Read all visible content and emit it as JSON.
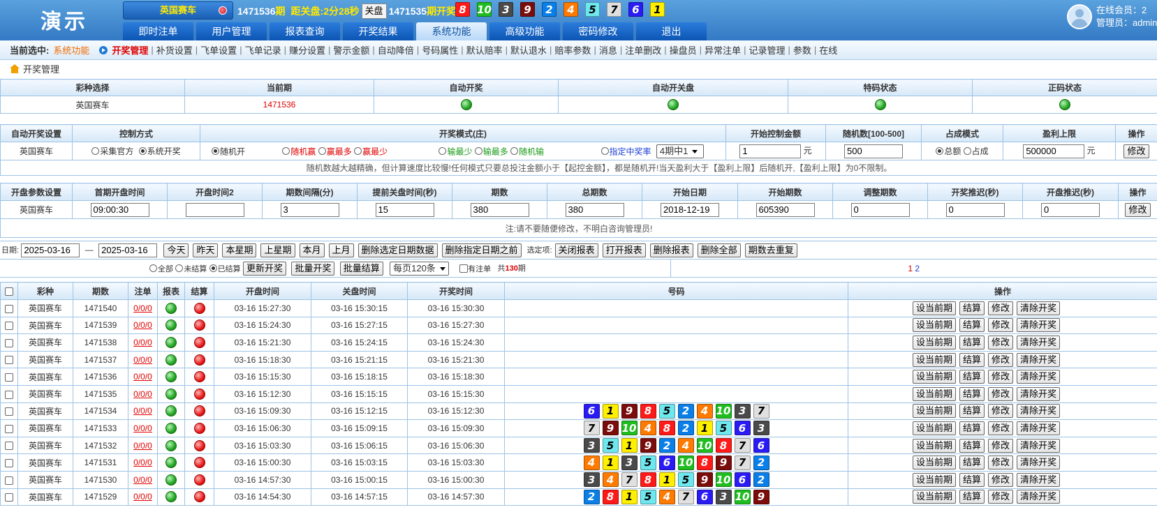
{
  "header": {
    "logo": "演示",
    "lottery": "英国赛车",
    "period": "1471536",
    "period_suffix": "期",
    "close_label": "距关盘:",
    "countdown": "2分28秒",
    "close_button": "关盘",
    "last_period": "1471535",
    "last_label": "期开奖:",
    "last_numbers": [
      8,
      10,
      3,
      9,
      2,
      4,
      5,
      7,
      6,
      1
    ],
    "online_label": "在线会员：2",
    "admin_label": "管理员：admin"
  },
  "nav": [
    "即时注单",
    "用户管理",
    "报表查询",
    "开奖结果",
    "系统功能",
    "高级功能",
    "密码修改",
    "退出"
  ],
  "subnav": {
    "current_label": "当前选中:",
    "current_value": "系统功能",
    "items": [
      "开奖管理",
      "补货设置",
      "飞单设置",
      "飞单记录",
      "赚分设置",
      "警示金额",
      "自动降倍",
      "号码属性",
      "默认赔率",
      "默认退水",
      "赔率参数",
      "消息",
      "注单删改",
      "操盘员",
      "异常注单",
      "记录管理",
      "参数",
      "在线"
    ]
  },
  "breadcrumb": "开奖管理",
  "status_table": {
    "headers": [
      "彩种选择",
      "当前期",
      "自动开奖",
      "自动开关盘",
      "特码状态",
      "正码状态"
    ],
    "lottery": "英国赛车",
    "period": "1471536"
  },
  "auto_table": {
    "headers": [
      "自动开奖设置",
      "控制方式",
      "开奖模式(庄)",
      "开始控制金额",
      "随机数[100-500]",
      "占成模式",
      "盈利上限",
      "操作"
    ],
    "lottery": "英国赛车",
    "control_options": [
      "采集官方",
      "系统开奖"
    ],
    "mode_options": [
      "随机开",
      "随机赢",
      "赢最多",
      "赢最少",
      "输最少",
      "输最多",
      "随机输",
      "指定中奖率"
    ],
    "rate_select": "4期中1",
    "start_amount": "1",
    "unit": "元",
    "random_num": "500",
    "share_options": [
      "总额",
      "占成"
    ],
    "profit_limit": "500000",
    "edit": "修改",
    "note": "随机数越大越精确，但计算速度比较慢!任何模式只要总投注金额小于【起控金额】，都是随机开!当天盈利大于【盈利上限】后随机开,【盈利上限】为0不限制。"
  },
  "param_table": {
    "headers": [
      "开盘参数设置",
      "首期开盘时间",
      "开盘时间2",
      "期数间隔(分)",
      "提前关盘时间(秒)",
      "期数",
      "总期数",
      "开始日期",
      "开始期数",
      "调整期数",
      "开奖推迟(秒)",
      "开盘推迟(秒)",
      "操作"
    ],
    "lottery": "英国赛车",
    "values": [
      "09:00:30",
      "",
      "3",
      "15",
      "380",
      "380",
      "2018-12-19",
      "605390",
      "0",
      "0",
      "0"
    ],
    "edit": "修改",
    "note": "注:请不要随便修改，不明白咨询管理员!"
  },
  "filter": {
    "date_label": "日期:",
    "date_from": "2025-03-16",
    "dash": "—",
    "date_to": "2025-03-16",
    "buttons": [
      "今天",
      "昨天",
      "本星期",
      "上星期",
      "本月",
      "上月",
      "删除选定日期数据",
      "删除指定日期之前"
    ],
    "options_label": "选定项:",
    "option_buttons": [
      "关闭报表",
      "打开报表",
      "删除报表",
      "删除全部",
      "期数去重复"
    ],
    "status_radios": [
      "全部",
      "未结算",
      "已结算"
    ],
    "update_btn": "更新开奖",
    "batch_open": "批量开奖",
    "batch_settle": "批量结算",
    "page_size": "每页120条",
    "has_bet": "有注单",
    "total_prefix": "共",
    "total": "130",
    "total_suffix": "期",
    "page1": "1",
    "page2": "2"
  },
  "results": {
    "headers": [
      "彩种",
      "期数",
      "注单",
      "报表",
      "结算",
      "开盘时间",
      "关盘时间",
      "开奖时间",
      "号码",
      "操作"
    ],
    "actions": [
      "设当前期",
      "结算",
      "修改",
      "清除开奖"
    ],
    "rows": [
      {
        "lottery": "英国赛车",
        "period": "1471540",
        "bets": "0/0/0",
        "open": "03-16 15:27:30",
        "close": "03-16 15:30:15",
        "draw": "03-16 15:30:30",
        "numbers": []
      },
      {
        "lottery": "英国赛车",
        "period": "1471539",
        "bets": "0/0/0",
        "open": "03-16 15:24:30",
        "close": "03-16 15:27:15",
        "draw": "03-16 15:27:30",
        "numbers": []
      },
      {
        "lottery": "英国赛车",
        "period": "1471538",
        "bets": "0/0/0",
        "open": "03-16 15:21:30",
        "close": "03-16 15:24:15",
        "draw": "03-16 15:24:30",
        "numbers": []
      },
      {
        "lottery": "英国赛车",
        "period": "1471537",
        "bets": "0/0/0",
        "open": "03-16 15:18:30",
        "close": "03-16 15:21:15",
        "draw": "03-16 15:21:30",
        "numbers": []
      },
      {
        "lottery": "英国赛车",
        "period": "1471536",
        "bets": "0/0/0",
        "open": "03-16 15:15:30",
        "close": "03-16 15:18:15",
        "draw": "03-16 15:18:30",
        "numbers": []
      },
      {
        "lottery": "英国赛车",
        "period": "1471535",
        "bets": "0/0/0",
        "open": "03-16 15:12:30",
        "close": "03-16 15:15:15",
        "draw": "03-16 15:15:30",
        "numbers": []
      },
      {
        "lottery": "英国赛车",
        "period": "1471534",
        "bets": "0/0/0",
        "open": "03-16 15:09:30",
        "close": "03-16 15:12:15",
        "draw": "03-16 15:12:30",
        "numbers": [
          6,
          1,
          9,
          8,
          5,
          2,
          4,
          10,
          3,
          7
        ]
      },
      {
        "lottery": "英国赛车",
        "period": "1471533",
        "bets": "0/0/0",
        "open": "03-16 15:06:30",
        "close": "03-16 15:09:15",
        "draw": "03-16 15:09:30",
        "numbers": [
          7,
          9,
          10,
          4,
          8,
          2,
          1,
          5,
          6,
          3
        ]
      },
      {
        "lottery": "英国赛车",
        "period": "1471532",
        "bets": "0/0/0",
        "open": "03-16 15:03:30",
        "close": "03-16 15:06:15",
        "draw": "03-16 15:06:30",
        "numbers": [
          3,
          5,
          1,
          9,
          2,
          4,
          10,
          8,
          7,
          6
        ]
      },
      {
        "lottery": "英国赛车",
        "period": "1471531",
        "bets": "0/0/0",
        "open": "03-16 15:00:30",
        "close": "03-16 15:03:15",
        "draw": "03-16 15:03:30",
        "numbers": [
          4,
          1,
          3,
          5,
          6,
          10,
          8,
          9,
          7,
          2
        ]
      },
      {
        "lottery": "英国赛车",
        "period": "1471530",
        "bets": "0/0/0",
        "open": "03-16 14:57:30",
        "close": "03-16 15:00:15",
        "draw": "03-16 15:00:30",
        "numbers": [
          3,
          4,
          7,
          8,
          1,
          5,
          9,
          10,
          6,
          2
        ]
      },
      {
        "lottery": "英国赛车",
        "period": "1471529",
        "bets": "0/0/0",
        "open": "03-16 14:54:30",
        "close": "03-16 14:57:15",
        "draw": "03-16 14:57:30",
        "numbers": [
          2,
          8,
          1,
          5,
          4,
          7,
          6,
          3,
          10,
          9
        ]
      }
    ]
  }
}
